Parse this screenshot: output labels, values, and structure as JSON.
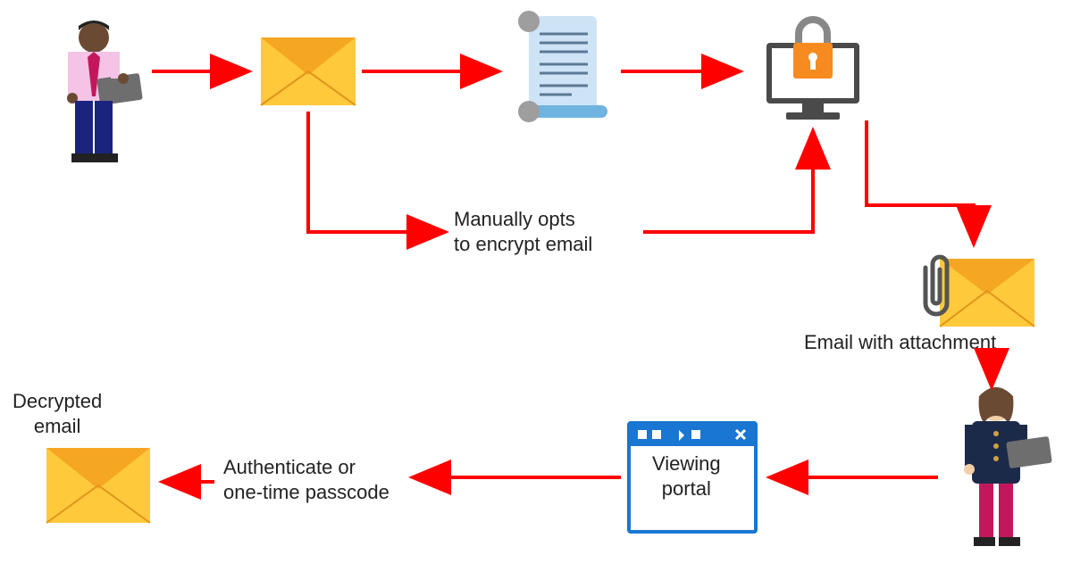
{
  "labels": {
    "manual_opt": "Manually opts\nto encrypt email",
    "email_attachment": "Email with attachment",
    "viewing_portal": "Viewing\nportal",
    "authenticate": "Authenticate or\none-time passcode",
    "decrypted": "Decrypted\nemail"
  },
  "nodes": {
    "sender": "sender-person",
    "email1": "email-icon",
    "scroll": "transport-rule-scroll",
    "locked_pc": "encryption-service",
    "email_attach": "email-attachment-icon",
    "recipient": "recipient-person",
    "portal": "viewing-portal-window",
    "email_decrypted": "decrypted-email-icon"
  }
}
